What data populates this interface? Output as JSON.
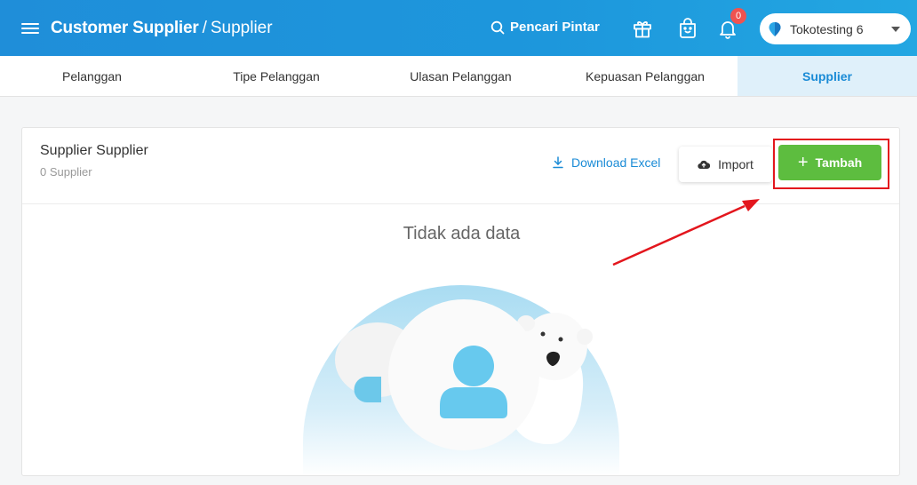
{
  "header": {
    "title": "Customer Supplier",
    "separator": "/",
    "subtitle": "Supplier",
    "smart_search": "Pencari Pintar",
    "notification_count": "0",
    "store_name": "Tokotesting 6"
  },
  "tabs": [
    {
      "label": "Pelanggan",
      "active": false
    },
    {
      "label": "Tipe Pelanggan",
      "active": false
    },
    {
      "label": "Ulasan Pelanggan",
      "active": false
    },
    {
      "label": "Kepuasan Pelanggan",
      "active": false
    },
    {
      "label": "Supplier",
      "active": true
    }
  ],
  "card": {
    "title": "Supplier Supplier",
    "count_label": "0 Supplier",
    "download_label": "Download Excel",
    "import_label": "Import",
    "add_label": "Tambah",
    "empty_text": "Tidak ada data"
  },
  "colors": {
    "header_blue": "#1d97dc",
    "accent_blue": "#1a8bd6",
    "add_green": "#5dbd3f",
    "highlight_red": "#e3161d"
  },
  "icons": [
    "menu-icon",
    "search-icon",
    "gift-icon",
    "shopping-bag-icon",
    "bell-icon",
    "store-pin-icon",
    "download-icon",
    "cloud-upload-icon",
    "plus-icon"
  ]
}
